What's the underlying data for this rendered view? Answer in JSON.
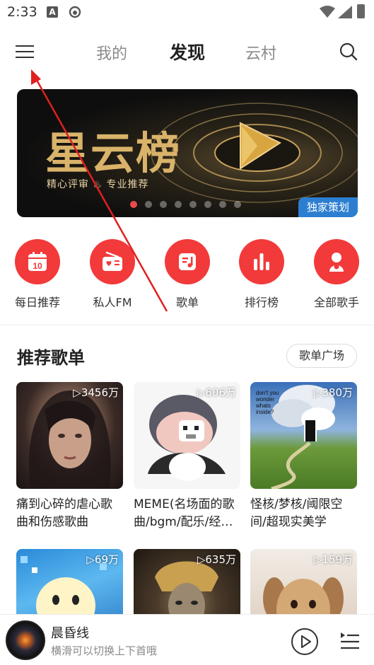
{
  "status_bar": {
    "time": "2:33",
    "notification_letter": "A"
  },
  "header": {
    "tabs": [
      {
        "label": "我的"
      },
      {
        "label": "发现"
      },
      {
        "label": "云村"
      }
    ],
    "active_tab": "发现"
  },
  "banner": {
    "title": "星云榜",
    "subtitle": "精心评审 ♨ 专业推荐",
    "tag": "独家策划",
    "dot_count": 8,
    "active_dot": 0
  },
  "entries": [
    {
      "label": "每日推荐",
      "icon": "calendar-icon",
      "badge": "10"
    },
    {
      "label": "私人FM",
      "icon": "radio-icon"
    },
    {
      "label": "歌单",
      "icon": "playlist-icon"
    },
    {
      "label": "排行榜",
      "icon": "rank-bars-icon"
    },
    {
      "label": "全部歌手",
      "icon": "singer-icon"
    }
  ],
  "section": {
    "title": "推荐歌单",
    "more_label": "歌单广场"
  },
  "playlists": [
    {
      "plays": "▷3456万",
      "title": "痛到心碎的虐心歌曲和伤感歌曲"
    },
    {
      "plays": "▷606万",
      "title": "MEME(名场面的歌曲/bgm/配乐/经…"
    },
    {
      "plays": "▷380万",
      "title": "怪核/梦核/阈限空间/超现实美学"
    },
    {
      "plays": "▷69万",
      "title": ""
    },
    {
      "plays": "▷635万",
      "title": ""
    },
    {
      "plays": "▷159万",
      "title": ""
    }
  ],
  "cover_texts": {
    "p3": [
      "don't you",
      "wonder",
      "whats",
      "inside?"
    ]
  },
  "player": {
    "title": "晨昏线",
    "subtitle": "横滑可以切换上下首哦"
  },
  "colors": {
    "accent": "#f23a3a",
    "banner_tag": "#2c7fd0",
    "annotation": "#e02020"
  }
}
